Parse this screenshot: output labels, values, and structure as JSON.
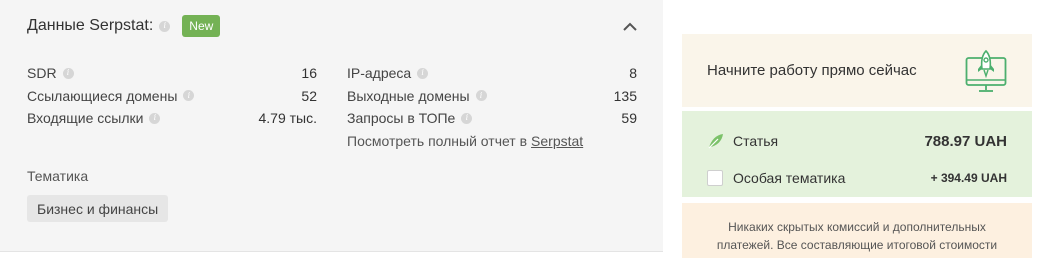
{
  "serpstat_panel": {
    "title": "Данные Serpstat:",
    "badge": "New",
    "left_stats": [
      {
        "label": "SDR",
        "value": "16"
      },
      {
        "label": "Ссылающиеся домены",
        "value": "52"
      },
      {
        "label": "Входящие ссылки",
        "value": "4.79 тыс."
      }
    ],
    "right_stats": [
      {
        "label": "IP-адреса",
        "value": "8"
      },
      {
        "label": "Выходные домены",
        "value": "135"
      },
      {
        "label": "Запросы в ТОПе",
        "value": "59"
      }
    ],
    "report_text": "Посмотреть полный отчет в",
    "report_link": "Serpstat",
    "topic_label": "Тематика",
    "topic_tag": "Бизнес и финансы"
  },
  "start_card": {
    "text": "Начните работу прямо сейчас",
    "icon": "rocket-monitor-icon"
  },
  "price_card": {
    "article_label": "Статья",
    "article_price": "788.97 UAH",
    "special_label": "Особая тематика",
    "special_price": "+ 394.49 UAH",
    "special_checked": false
  },
  "notice": {
    "text": "Никаких скрытых комиссий и дополнительных платежей. Все составляющие итоговой стоимости"
  },
  "colors": {
    "badge_green": "#74b255",
    "icon_green": "#4caf6e",
    "panel_bg": "#f5f5f5",
    "start_bg": "#faf5ea",
    "price_bg": "#e4f2dc",
    "notice_bg": "#fdf0e0"
  }
}
